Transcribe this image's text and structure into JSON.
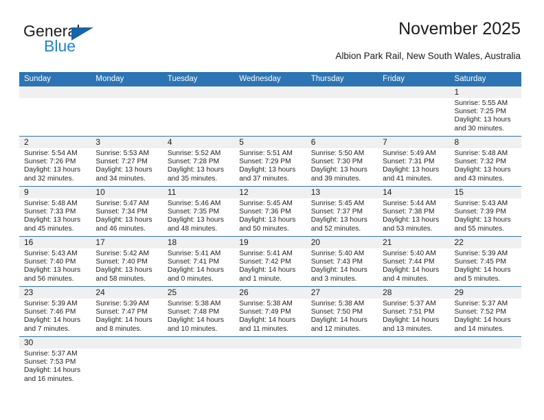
{
  "brand": {
    "name_top": "General",
    "name_bottom": "Blue",
    "accent_color": "#1c83d4",
    "triangle_color": "#1565a8"
  },
  "header": {
    "title": "November 2025",
    "subtitle": "Albion Park Rail, New South Wales, Australia"
  },
  "theme": {
    "header_bar_color": "#2c74b3",
    "date_band_color": "#f0f0f0",
    "row_separator_color": "#2c74b3"
  },
  "calendar": {
    "weekday_headers": [
      "Sunday",
      "Monday",
      "Tuesday",
      "Wednesday",
      "Thursday",
      "Friday",
      "Saturday"
    ],
    "weeks": [
      [
        {
          "day": "",
          "sunrise": "",
          "sunset": "",
          "daylight_1": "",
          "daylight_2": "",
          "empty": true
        },
        {
          "day": "",
          "sunrise": "",
          "sunset": "",
          "daylight_1": "",
          "daylight_2": "",
          "empty": true
        },
        {
          "day": "",
          "sunrise": "",
          "sunset": "",
          "daylight_1": "",
          "daylight_2": "",
          "empty": true
        },
        {
          "day": "",
          "sunrise": "",
          "sunset": "",
          "daylight_1": "",
          "daylight_2": "",
          "empty": true
        },
        {
          "day": "",
          "sunrise": "",
          "sunset": "",
          "daylight_1": "",
          "daylight_2": "",
          "empty": true
        },
        {
          "day": "",
          "sunrise": "",
          "sunset": "",
          "daylight_1": "",
          "daylight_2": "",
          "empty": true
        },
        {
          "day": "1",
          "sunrise": "Sunrise: 5:55 AM",
          "sunset": "Sunset: 7:25 PM",
          "daylight_1": "Daylight: 13 hours",
          "daylight_2": "and 30 minutes."
        }
      ],
      [
        {
          "day": "2",
          "sunrise": "Sunrise: 5:54 AM",
          "sunset": "Sunset: 7:26 PM",
          "daylight_1": "Daylight: 13 hours",
          "daylight_2": "and 32 minutes."
        },
        {
          "day": "3",
          "sunrise": "Sunrise: 5:53 AM",
          "sunset": "Sunset: 7:27 PM",
          "daylight_1": "Daylight: 13 hours",
          "daylight_2": "and 34 minutes."
        },
        {
          "day": "4",
          "sunrise": "Sunrise: 5:52 AM",
          "sunset": "Sunset: 7:28 PM",
          "daylight_1": "Daylight: 13 hours",
          "daylight_2": "and 35 minutes."
        },
        {
          "day": "5",
          "sunrise": "Sunrise: 5:51 AM",
          "sunset": "Sunset: 7:29 PM",
          "daylight_1": "Daylight: 13 hours",
          "daylight_2": "and 37 minutes."
        },
        {
          "day": "6",
          "sunrise": "Sunrise: 5:50 AM",
          "sunset": "Sunset: 7:30 PM",
          "daylight_1": "Daylight: 13 hours",
          "daylight_2": "and 39 minutes."
        },
        {
          "day": "7",
          "sunrise": "Sunrise: 5:49 AM",
          "sunset": "Sunset: 7:31 PM",
          "daylight_1": "Daylight: 13 hours",
          "daylight_2": "and 41 minutes."
        },
        {
          "day": "8",
          "sunrise": "Sunrise: 5:48 AM",
          "sunset": "Sunset: 7:32 PM",
          "daylight_1": "Daylight: 13 hours",
          "daylight_2": "and 43 minutes."
        }
      ],
      [
        {
          "day": "9",
          "sunrise": "Sunrise: 5:48 AM",
          "sunset": "Sunset: 7:33 PM",
          "daylight_1": "Daylight: 13 hours",
          "daylight_2": "and 45 minutes."
        },
        {
          "day": "10",
          "sunrise": "Sunrise: 5:47 AM",
          "sunset": "Sunset: 7:34 PM",
          "daylight_1": "Daylight: 13 hours",
          "daylight_2": "and 46 minutes."
        },
        {
          "day": "11",
          "sunrise": "Sunrise: 5:46 AM",
          "sunset": "Sunset: 7:35 PM",
          "daylight_1": "Daylight: 13 hours",
          "daylight_2": "and 48 minutes."
        },
        {
          "day": "12",
          "sunrise": "Sunrise: 5:45 AM",
          "sunset": "Sunset: 7:36 PM",
          "daylight_1": "Daylight: 13 hours",
          "daylight_2": "and 50 minutes."
        },
        {
          "day": "13",
          "sunrise": "Sunrise: 5:45 AM",
          "sunset": "Sunset: 7:37 PM",
          "daylight_1": "Daylight: 13 hours",
          "daylight_2": "and 52 minutes."
        },
        {
          "day": "14",
          "sunrise": "Sunrise: 5:44 AM",
          "sunset": "Sunset: 7:38 PM",
          "daylight_1": "Daylight: 13 hours",
          "daylight_2": "and 53 minutes."
        },
        {
          "day": "15",
          "sunrise": "Sunrise: 5:43 AM",
          "sunset": "Sunset: 7:39 PM",
          "daylight_1": "Daylight: 13 hours",
          "daylight_2": "and 55 minutes."
        }
      ],
      [
        {
          "day": "16",
          "sunrise": "Sunrise: 5:43 AM",
          "sunset": "Sunset: 7:40 PM",
          "daylight_1": "Daylight: 13 hours",
          "daylight_2": "and 56 minutes."
        },
        {
          "day": "17",
          "sunrise": "Sunrise: 5:42 AM",
          "sunset": "Sunset: 7:40 PM",
          "daylight_1": "Daylight: 13 hours",
          "daylight_2": "and 58 minutes."
        },
        {
          "day": "18",
          "sunrise": "Sunrise: 5:41 AM",
          "sunset": "Sunset: 7:41 PM",
          "daylight_1": "Daylight: 14 hours",
          "daylight_2": "and 0 minutes."
        },
        {
          "day": "19",
          "sunrise": "Sunrise: 5:41 AM",
          "sunset": "Sunset: 7:42 PM",
          "daylight_1": "Daylight: 14 hours",
          "daylight_2": "and 1 minute."
        },
        {
          "day": "20",
          "sunrise": "Sunrise: 5:40 AM",
          "sunset": "Sunset: 7:43 PM",
          "daylight_1": "Daylight: 14 hours",
          "daylight_2": "and 3 minutes."
        },
        {
          "day": "21",
          "sunrise": "Sunrise: 5:40 AM",
          "sunset": "Sunset: 7:44 PM",
          "daylight_1": "Daylight: 14 hours",
          "daylight_2": "and 4 minutes."
        },
        {
          "day": "22",
          "sunrise": "Sunrise: 5:39 AM",
          "sunset": "Sunset: 7:45 PM",
          "daylight_1": "Daylight: 14 hours",
          "daylight_2": "and 5 minutes."
        }
      ],
      [
        {
          "day": "23",
          "sunrise": "Sunrise: 5:39 AM",
          "sunset": "Sunset: 7:46 PM",
          "daylight_1": "Daylight: 14 hours",
          "daylight_2": "and 7 minutes."
        },
        {
          "day": "24",
          "sunrise": "Sunrise: 5:39 AM",
          "sunset": "Sunset: 7:47 PM",
          "daylight_1": "Daylight: 14 hours",
          "daylight_2": "and 8 minutes."
        },
        {
          "day": "25",
          "sunrise": "Sunrise: 5:38 AM",
          "sunset": "Sunset: 7:48 PM",
          "daylight_1": "Daylight: 14 hours",
          "daylight_2": "and 10 minutes."
        },
        {
          "day": "26",
          "sunrise": "Sunrise: 5:38 AM",
          "sunset": "Sunset: 7:49 PM",
          "daylight_1": "Daylight: 14 hours",
          "daylight_2": "and 11 minutes."
        },
        {
          "day": "27",
          "sunrise": "Sunrise: 5:38 AM",
          "sunset": "Sunset: 7:50 PM",
          "daylight_1": "Daylight: 14 hours",
          "daylight_2": "and 12 minutes."
        },
        {
          "day": "28",
          "sunrise": "Sunrise: 5:37 AM",
          "sunset": "Sunset: 7:51 PM",
          "daylight_1": "Daylight: 14 hours",
          "daylight_2": "and 13 minutes."
        },
        {
          "day": "29",
          "sunrise": "Sunrise: 5:37 AM",
          "sunset": "Sunset: 7:52 PM",
          "daylight_1": "Daylight: 14 hours",
          "daylight_2": "and 14 minutes."
        }
      ],
      [
        {
          "day": "30",
          "sunrise": "Sunrise: 5:37 AM",
          "sunset": "Sunset: 7:53 PM",
          "daylight_1": "Daylight: 14 hours",
          "daylight_2": "and 16 minutes."
        },
        {
          "day": "",
          "sunrise": "",
          "sunset": "",
          "daylight_1": "",
          "daylight_2": "",
          "empty": true
        },
        {
          "day": "",
          "sunrise": "",
          "sunset": "",
          "daylight_1": "",
          "daylight_2": "",
          "empty": true
        },
        {
          "day": "",
          "sunrise": "",
          "sunset": "",
          "daylight_1": "",
          "daylight_2": "",
          "empty": true
        },
        {
          "day": "",
          "sunrise": "",
          "sunset": "",
          "daylight_1": "",
          "daylight_2": "",
          "empty": true
        },
        {
          "day": "",
          "sunrise": "",
          "sunset": "",
          "daylight_1": "",
          "daylight_2": "",
          "empty": true
        },
        {
          "day": "",
          "sunrise": "",
          "sunset": "",
          "daylight_1": "",
          "daylight_2": "",
          "empty": true
        }
      ]
    ]
  }
}
